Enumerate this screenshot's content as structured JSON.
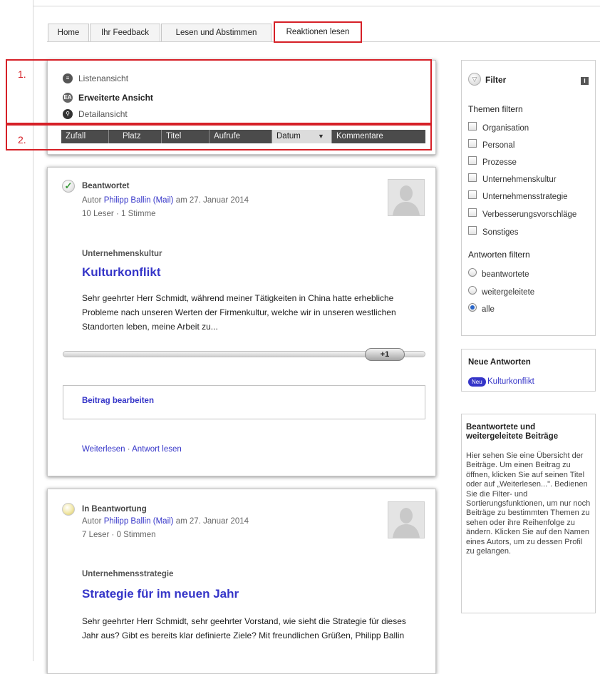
{
  "nav": {
    "tabs": [
      {
        "label": "Home"
      },
      {
        "label": "Ihr Feedback"
      },
      {
        "label": "Lesen und Abstimmen"
      },
      {
        "label": "Reaktionen lesen"
      }
    ]
  },
  "annotations": {
    "marker1": "1.",
    "marker2": "2."
  },
  "views": {
    "list": "Listenansicht",
    "extended": "Erweiterte Ansicht",
    "detail": "Detailansicht"
  },
  "sort": {
    "items": [
      "Zufall",
      "Platz",
      "Titel",
      "Aufrufe",
      "Datum",
      "Kommentare"
    ],
    "active_index": 4
  },
  "posts": [
    {
      "status": "Beantwortet",
      "author_prefix": "Autor",
      "author": "Philipp Ballin",
      "mail": "(Mail)",
      "date_text": "am 27. Januar 2014",
      "stats": "10 Leser · 1 Stimme",
      "category": "Unternehmenskultur",
      "title": "Kulturkonflikt",
      "excerpt": "Sehr geehrter Herr Schmidt, während meiner Tätigkeiten in China hatte erhebliche Probleme nach unseren Werten der Firmenkultur, welche wir in unseren westlichen Standorten leben, meine Arbeit zu...",
      "vote_label": "+1",
      "edit_link": "Beitrag bearbeiten",
      "read_more": "Weiterlesen",
      "separator": "·",
      "answer_link": "Antwort lesen"
    },
    {
      "status": "In Beantwortung",
      "author_prefix": "Autor",
      "author": "Philipp Ballin",
      "mail": "(Mail)",
      "date_text": "am 27. Januar 2014",
      "stats": "7 Leser · 0 Stimmen",
      "category": "Unternehmensstrategie",
      "title": "Strategie für im neuen Jahr",
      "excerpt": "Sehr geehrter Herr Schmidt, sehr geehrter Vorstand, wie sieht die Strategie für dieses Jahr aus? Gibt es bereits klar definierte Ziele? Mit freundlichen Grüßen, Philipp Ballin"
    }
  ],
  "filter": {
    "title": "Filter",
    "info_icon": "i",
    "topics_heading": "Themen filtern",
    "topics": [
      "Organisation",
      "Personal",
      "Prozesse",
      "Unternehmenskultur",
      "Unternehmensstrategie",
      "Verbesserungsvorschläge",
      "Sonstiges"
    ],
    "answers_heading": "Antworten filtern",
    "answers": [
      "beantwortete",
      "weitergeleitete",
      "alle"
    ],
    "answers_selected": "alle"
  },
  "new_answers": {
    "heading": "Neue Antworten",
    "badge": "Neu",
    "item": "Kulturkonflikt"
  },
  "help": {
    "heading": "Beantwortete und weitergeleitete Beiträge",
    "text": "Hier sehen Sie eine Übersicht der Beiträge. Um einen Beitrag zu öffnen, klicken Sie auf seinen Titel oder auf „Weiterlesen...\". Bedienen Sie die Filter- und Sortierungsfunktionen, um nur noch Beiträge zu bestimmten Themen zu sehen oder ihre Reihenfolge zu ändern. Klicken Sie auf den Namen eines Autors, um zu dessen Profil zu gelangen."
  },
  "colors": {
    "accent_red": "#d62027",
    "link_blue": "#3535c8",
    "sortbar": "#4b4b4b"
  }
}
